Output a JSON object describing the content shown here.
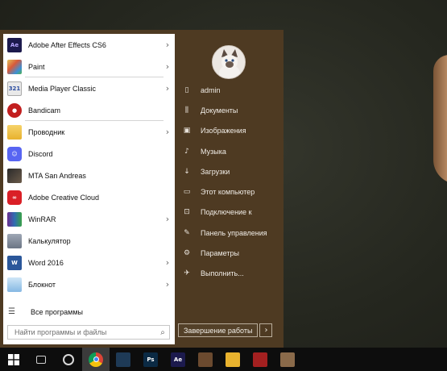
{
  "start_menu": {
    "apps": [
      {
        "label": "Adobe After Effects CS6",
        "icon": "after-effects-icon",
        "icon_text": "Ae",
        "has_submenu": true
      },
      {
        "label": "Paint",
        "icon": "paint-icon",
        "icon_text": "",
        "has_submenu": true
      },
      {
        "label": "Media Player Classic",
        "icon": "media-player-classic-icon",
        "icon_text": "321",
        "has_submenu": true
      },
      {
        "label": "Bandicam",
        "icon": "bandicam-icon",
        "icon_text": "●",
        "has_submenu": false
      },
      {
        "label": "Проводник",
        "icon": "explorer-icon",
        "icon_text": "",
        "has_submenu": true
      },
      {
        "label": "Discord",
        "icon": "discord-icon",
        "icon_text": "☺",
        "has_submenu": false
      },
      {
        "label": "MTA San Andreas",
        "icon": "mta-icon",
        "icon_text": "",
        "has_submenu": false
      },
      {
        "label": "Adobe Creative Cloud",
        "icon": "creative-cloud-icon",
        "icon_text": "∞",
        "has_submenu": false
      },
      {
        "label": "WinRAR",
        "icon": "winrar-icon",
        "icon_text": "",
        "has_submenu": true
      },
      {
        "label": "Калькулятор",
        "icon": "calculator-icon",
        "icon_text": "",
        "has_submenu": false
      },
      {
        "label": "Word 2016",
        "icon": "word-icon",
        "icon_text": "W",
        "has_submenu": true
      },
      {
        "label": "Блокнот",
        "icon": "notepad-icon",
        "icon_text": "",
        "has_submenu": true
      }
    ],
    "all_programs": "Все программы",
    "search_placeholder": "Найти программы и файлы",
    "right_items": [
      {
        "label": "admin",
        "icon": "user-icon",
        "glyph": "▯"
      },
      {
        "label": "Документы",
        "icon": "documents-icon",
        "glyph": "⫼"
      },
      {
        "label": "Изображения",
        "icon": "pictures-icon",
        "glyph": "▣"
      },
      {
        "label": "Музыка",
        "icon": "music-icon",
        "glyph": "♪"
      },
      {
        "label": "Загрузки",
        "icon": "downloads-icon",
        "glyph": "↓"
      },
      {
        "label": "Этот компьютер",
        "icon": "computer-icon",
        "glyph": "▭"
      },
      {
        "label": "Подключение к",
        "icon": "connect-icon",
        "glyph": "⊡"
      },
      {
        "label": "Панель управления",
        "icon": "control-panel-icon",
        "glyph": "✎"
      },
      {
        "label": "Параметры",
        "icon": "settings-gear-icon",
        "glyph": "⚙"
      },
      {
        "label": "Выполнить...",
        "icon": "run-icon",
        "glyph": "✈"
      }
    ],
    "shutdown_label": "Завершение работы"
  },
  "taskbar": {
    "items": [
      {
        "name": "task-view-icon",
        "text": "",
        "color": "#0d0d0d"
      },
      {
        "name": "obs-icon",
        "text": "",
        "color": "#0d0d0d"
      },
      {
        "name": "chrome-icon",
        "text": "",
        "color": "#0d0d0d"
      },
      {
        "name": "film-strip-icon",
        "text": "",
        "color": "#1e3a56"
      },
      {
        "name": "photoshop-icon",
        "text": "Ps",
        "color": "#0b2a44"
      },
      {
        "name": "after-effects-icon",
        "text": "Ae",
        "color": "#1c1a4d"
      },
      {
        "name": "game-icon",
        "text": "",
        "color": "#6b4a2f"
      },
      {
        "name": "file-explorer-icon",
        "text": "",
        "color": "#e8b22e"
      },
      {
        "name": "red-app-icon",
        "text": "",
        "color": "#a32020"
      },
      {
        "name": "photo-app-icon",
        "text": "",
        "color": "#8a6a4a"
      }
    ],
    "active_index": 2
  },
  "colors": {
    "start_menu_bg": "#4e3a22",
    "taskbar_bg": "#0d0d0d",
    "left_panel_bg": "#ffffff"
  }
}
